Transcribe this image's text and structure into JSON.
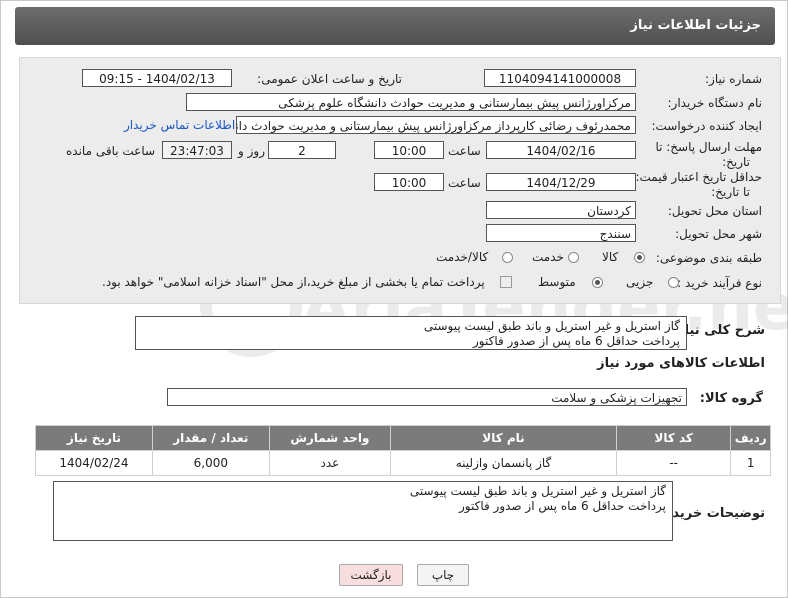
{
  "header": {
    "title": "جزئیات اطلاعات نیاز"
  },
  "fields": {
    "need_number_label": "شماره نیاز:",
    "need_number": "1104094141000008",
    "announce_label": "تاریخ و ساعت اعلان عمومی:",
    "announce_value": "1404/02/13 - 09:15",
    "buyer_label": "نام دستگاه خریدار:",
    "buyer_value": "مرکزاورژانس پیش بیمارستانی و مدیریت حوادث دانشگاه علوم پزشکی",
    "creator_label": "ایجاد کننده درخواست:",
    "creator_value": "محمدرئوف رضائی کارپرداز مرکزاورژانس پیش بیمارستانی و مدیریت حوادث دانشگ",
    "contact_link": "اطلاعات تماس خریدار",
    "deadline_label_1": "مهلت ارسال پاسخ: تا",
    "deadline_label_2": "تاریخ:",
    "deadline_date": "1404/02/16",
    "time_label": "ساعت",
    "deadline_time": "10:00",
    "days_value": "2",
    "days_label": "روز و",
    "remaining_value": "23:47:03",
    "remaining_label": "ساعت باقی مانده",
    "min_price_label_1": "حداقل تاریخ اعتبار قیمت:",
    "min_price_label_2": "تا تاریخ:",
    "price_date": "1404/12/29",
    "price_time": "10:00",
    "province_label": "استان محل تحویل:",
    "province_value": "کردستان",
    "city_label": "شهر محل تحویل:",
    "city_value": "سنندج",
    "category_label": "طبقه بندی موضوعی:",
    "category_options": [
      "کالا",
      "خدمت",
      "کالا/خدمت"
    ],
    "process_label": "نوع فرآیند خرید :",
    "process_options": [
      "جزیی",
      "متوسط"
    ],
    "payment_note": "پرداخت تمام یا بخشی از مبلغ خرید،از محل \"اسناد خزانه اسلامی\" خواهد بود."
  },
  "description": {
    "label": "شرح کلی نیاز:",
    "text": "گاز استریل و غیر استریل و باند طبق لیست پیوستی\nپرداخت حداقل 6 ماه پس از صدور فاکتور"
  },
  "goods": {
    "section_title": "اطلاعات کالاهای مورد نیاز",
    "group_label": "گروه کالا:",
    "group_value": "تجهیزات پزشکی و سلامت",
    "columns": [
      "ردیف",
      "کد کالا",
      "نام کالا",
      "واحد شمارش",
      "تعداد / مقدار",
      "تاریخ نیاز"
    ],
    "rows": [
      [
        "1",
        "--",
        "گاز پانسمان وازلینه",
        "عدد",
        "6,000",
        "1404/02/24"
      ]
    ]
  },
  "buyer_notes": {
    "label": "توضیحات خریدار:",
    "text": "گاز استریل و غیر استریل و باند طبق لیست پیوستی\nپرداخت حداقل 6 ماه پس از صدور فاکتور"
  },
  "buttons": {
    "print": "چاپ",
    "back": "بازگشت"
  },
  "watermark": {
    "text": "AriaTender.neT"
  },
  "colors": {
    "header_bg": "#5c5c5c",
    "form_bg": "#ececec",
    "link": "#1a57c7",
    "back_button_bg": "#f8dede"
  }
}
